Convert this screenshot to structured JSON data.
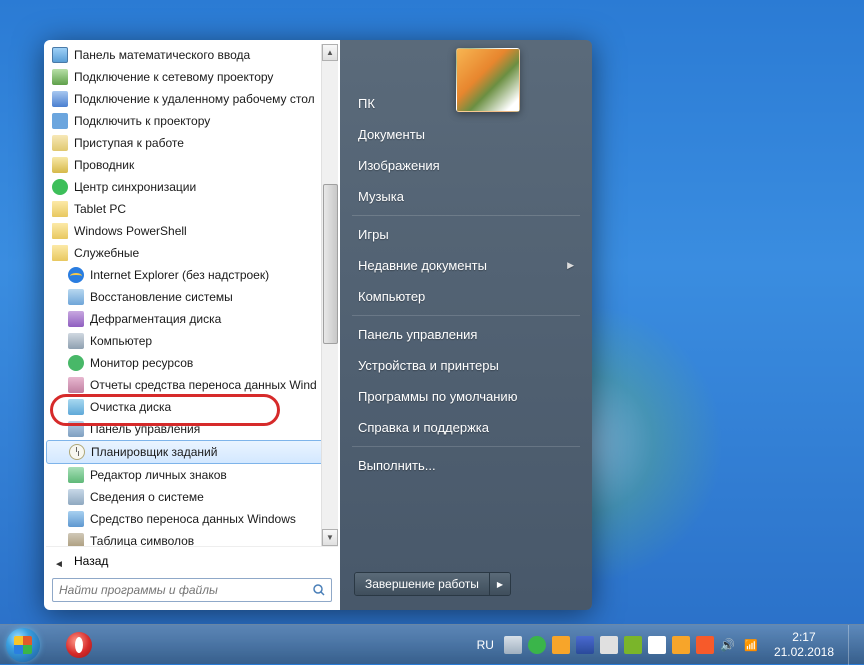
{
  "user_picture_alt": "flower",
  "programs": [
    {
      "label": "Панель математического ввода",
      "icon": "ic-math",
      "indent": false
    },
    {
      "label": "Подключение к сетевому проектору",
      "icon": "ic-netproj",
      "indent": false
    },
    {
      "label": "Подключение к удаленному рабочему стол",
      "icon": "ic-rdp",
      "indent": false
    },
    {
      "label": "Подключить к проектору",
      "icon": "ic-proj",
      "indent": false
    },
    {
      "label": "Приступая к работе",
      "icon": "ic-start",
      "indent": false
    },
    {
      "label": "Проводник",
      "icon": "ic-explorer",
      "indent": false
    },
    {
      "label": "Центр синхронизации",
      "icon": "ic-sync",
      "indent": false
    },
    {
      "label": "Tablet PC",
      "icon": "ic-folder",
      "indent": false,
      "expandable": true
    },
    {
      "label": "Windows PowerShell",
      "icon": "ic-folder",
      "indent": false,
      "expandable": true
    },
    {
      "label": "Служебные",
      "icon": "ic-folder",
      "indent": false,
      "expandable": true
    },
    {
      "label": "Internet Explorer (без надстроек)",
      "icon": "ic-ie",
      "indent": true
    },
    {
      "label": "Восстановление системы",
      "icon": "ic-restore",
      "indent": true
    },
    {
      "label": "Дефрагментация диска",
      "icon": "ic-defrag",
      "indent": true
    },
    {
      "label": "Компьютер",
      "icon": "ic-computer",
      "indent": true
    },
    {
      "label": "Монитор ресурсов",
      "icon": "ic-monitor",
      "indent": true
    },
    {
      "label": "Отчеты средства переноса данных Wind",
      "icon": "ic-report",
      "indent": true
    },
    {
      "label": "Очистка диска",
      "icon": "ic-cleanup",
      "indent": true
    },
    {
      "label": "Панель управления",
      "icon": "ic-cpanel",
      "indent": true
    },
    {
      "label": "Планировщик заданий",
      "icon": "ic-sched",
      "indent": true,
      "highlight": true
    },
    {
      "label": "Редактор личных знаков",
      "icon": "ic-regedit",
      "indent": true
    },
    {
      "label": "Сведения о системе",
      "icon": "ic-sysinfo",
      "indent": true
    },
    {
      "label": "Средство переноса данных Windows",
      "icon": "ic-migwiz",
      "indent": true
    },
    {
      "label": "Таблица символов",
      "icon": "ic-charmap",
      "indent": true
    }
  ],
  "back_label": "Назад",
  "search_placeholder": "Найти программы и файлы",
  "right_items": [
    {
      "label": "ПК"
    },
    {
      "label": "Документы"
    },
    {
      "label": "Изображения"
    },
    {
      "label": "Музыка"
    },
    {
      "sep": true
    },
    {
      "label": "Игры"
    },
    {
      "label": "Недавние документы",
      "arrow": true
    },
    {
      "label": "Компьютер"
    },
    {
      "sep": true
    },
    {
      "label": "Панель управления"
    },
    {
      "label": "Устройства и принтеры"
    },
    {
      "label": "Программы по умолчанию"
    },
    {
      "label": "Справка и поддержка"
    },
    {
      "sep": true
    },
    {
      "label": "Выполнить..."
    }
  ],
  "shutdown_label": "Завершение работы",
  "taskbar": {
    "lang": "RU",
    "time": "2:17",
    "date": "21.02.2018"
  }
}
